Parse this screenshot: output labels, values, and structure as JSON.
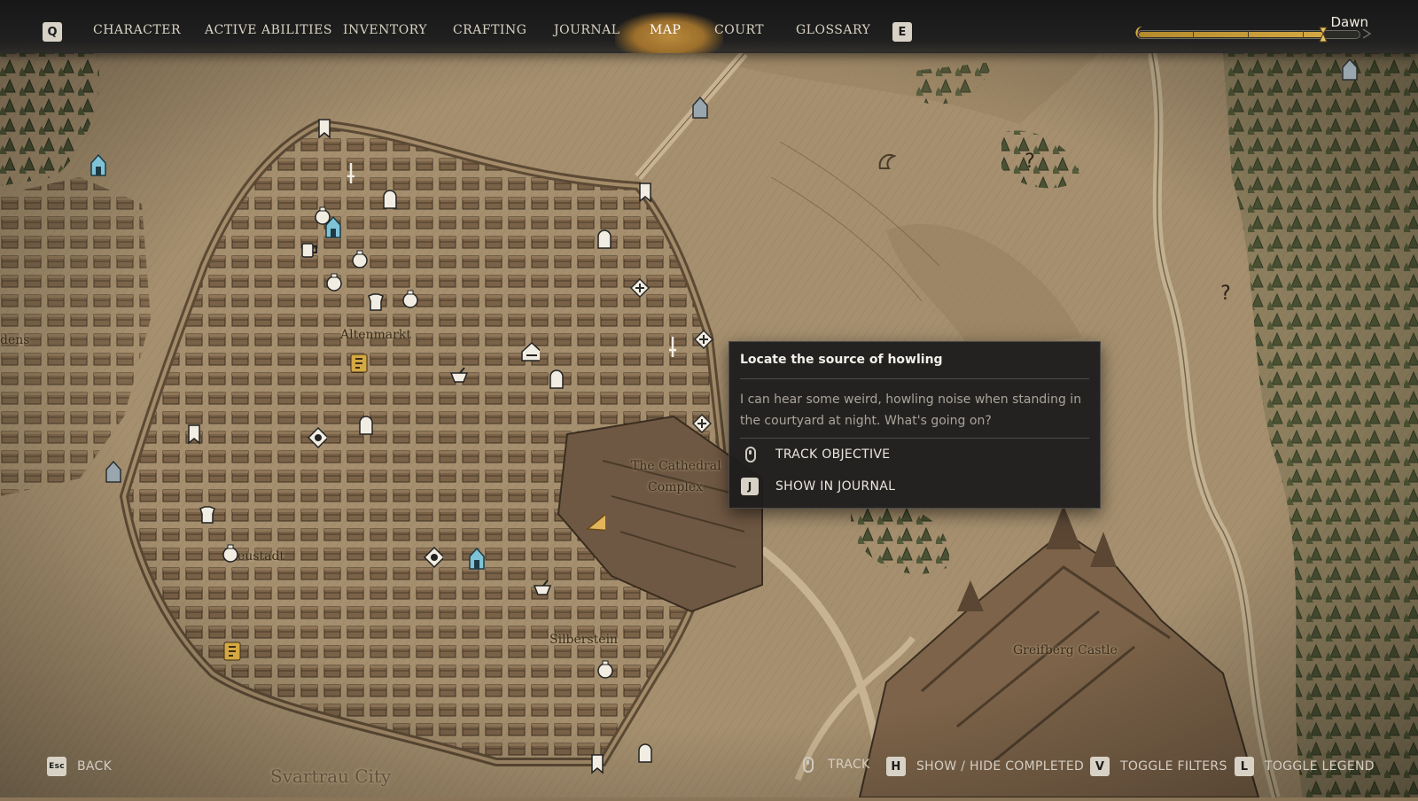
{
  "nav": {
    "prev_key": "Q",
    "next_key": "E",
    "tabs": [
      {
        "label": "CHARACTER",
        "active": false
      },
      {
        "label": "ACTIVE ABILITIES",
        "active": false
      },
      {
        "label": "INVENTORY",
        "active": false
      },
      {
        "label": "CRAFTING",
        "active": false
      },
      {
        "label": "JOURNAL",
        "active": false
      },
      {
        "label": "MAP",
        "active": true
      },
      {
        "label": "COURT",
        "active": false
      },
      {
        "label": "GLOSSARY",
        "active": false
      }
    ]
  },
  "time_of_day": {
    "label": "Dawn",
    "progress": 0.84
  },
  "map": {
    "labels": {
      "altenmarkt": "Altenmarkt",
      "cathedral_line1": "The Cathedral",
      "cathedral_line2": "Complex",
      "neustadt": "eustadt",
      "silberstein": "Silberstein",
      "greifberg": "Greifberg Castle",
      "city": "Svartrau City",
      "gardens": "dens"
    },
    "unknown_marker": "?"
  },
  "quest_popup": {
    "title": "Locate the source of howling",
    "description": "I can hear some weird, howling noise when standing in the courtyard at night. What's going on?",
    "track_label": "TRACK OBJECTIVE",
    "journal_key": "J",
    "journal_label": "SHOW IN JOURNAL"
  },
  "hints": {
    "back_key": "Esc",
    "back_label": "BACK",
    "track_label": "TRACK",
    "completed_key": "H",
    "completed_label": "SHOW / HIDE COMPLETED",
    "filters_key": "V",
    "filters_label": "TOGGLE FILTERS",
    "legend_key": "L",
    "legend_label": "TOGGLE LEGEND"
  },
  "colors": {
    "parchment": "#a89273",
    "accent_gold": "#d4a842",
    "panel": "#1c1c1c"
  }
}
